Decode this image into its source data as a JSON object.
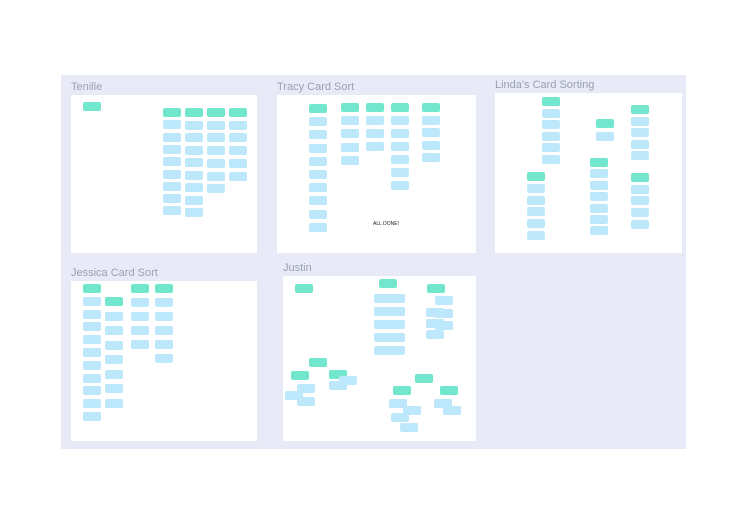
{
  "colors": {
    "canvas": "#e8ebf7",
    "panel": "#ffffff",
    "header_card": "#73e7cd",
    "card": "#bde8fb"
  },
  "boards": [
    {
      "id": "tenille",
      "title": "Tenille"
    },
    {
      "id": "tracy",
      "title": "Tracy Card Sort",
      "note": "ALL DONE!"
    },
    {
      "id": "linda",
      "title": "Linda's Card Sorting"
    },
    {
      "id": "jessica",
      "title": "Jessica Card Sort"
    },
    {
      "id": "justin",
      "title": "Justin"
    }
  ]
}
